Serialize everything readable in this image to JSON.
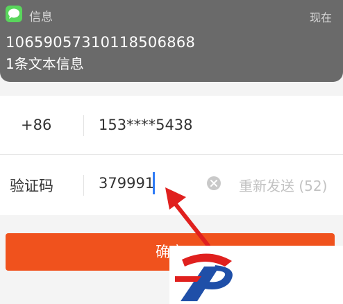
{
  "notification": {
    "app_name": "信息",
    "time": "现在",
    "sender": "10659057310118506868",
    "body": "1条文本信息",
    "app_icon": "messages-icon"
  },
  "form": {
    "phone": {
      "country_code": "+86",
      "number": "153****5438"
    },
    "code": {
      "label": "验证码",
      "value": "379991",
      "clear_icon": "clear-icon",
      "resend_text": "重新发送 (52)"
    }
  },
  "confirm_button": {
    "label": "确定"
  },
  "colors": {
    "accent": "#f0521d",
    "arrow": "#e0201e",
    "cursor": "#2f7cf6",
    "notification_bg": "#6a6a6a",
    "messages_icon": "#59d65c"
  }
}
